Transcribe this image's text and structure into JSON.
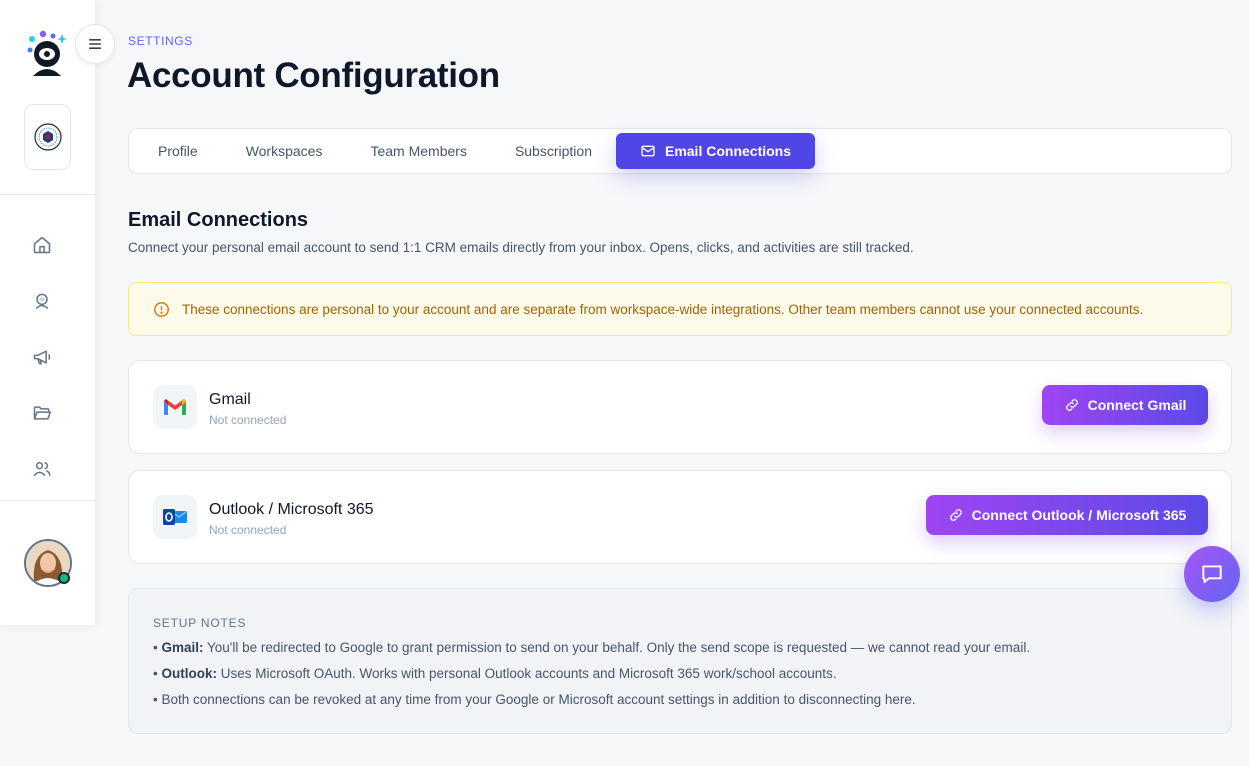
{
  "header": {
    "eyebrow": "SETTINGS",
    "title": "Account Configuration"
  },
  "tabs": [
    {
      "label": "Profile",
      "active": false
    },
    {
      "label": "Workspaces",
      "active": false
    },
    {
      "label": "Team Members",
      "active": false
    },
    {
      "label": "Subscription",
      "active": false
    },
    {
      "label": "Email Connections",
      "active": true,
      "icon": "mail-icon"
    }
  ],
  "section": {
    "title": "Email Connections",
    "description": "Connect your personal email account to send 1:1 CRM emails directly from your inbox. Opens, clicks, and activities are still tracked."
  },
  "notice": {
    "icon": "info-circle-icon",
    "text": "These connections are personal to your account and are separate from workspace-wide integrations. Other team members cannot use your connected accounts."
  },
  "connections": [
    {
      "name": "Gmail",
      "status": "Not connected",
      "button": "Connect Gmail",
      "icon": "gmail-icon"
    },
    {
      "name": "Outlook / Microsoft 365",
      "status": "Not connected",
      "button": "Connect Outlook / Microsoft 365",
      "icon": "outlook-icon"
    }
  ],
  "notes": {
    "title": "SETUP NOTES",
    "gmail_label": "Gmail:",
    "gmail_text": " You'll be redirected to Google to grant permission to send on your behalf. Only the send scope is requested — we cannot read your email.",
    "outlook_label": "Outlook:",
    "outlook_text": " Uses Microsoft OAuth. Works with personal Outlook accounts and Microsoft 365 work/school accounts.",
    "revoke_text": "Both connections can be revoked at any time from your Google or Microsoft account settings in addition to disconnecting here."
  },
  "sidebar": {
    "nav": [
      "home-icon",
      "astronaut-icon",
      "megaphone-icon",
      "folder-icon",
      "users-icon"
    ]
  },
  "colors": {
    "accent": "#4f46e5",
    "button_gradient_start": "#9f45f2",
    "button_gradient_end": "#5b4ae8",
    "notice_bg": "#fefbea",
    "notice_text": "#a16207",
    "online": "#10b981"
  }
}
